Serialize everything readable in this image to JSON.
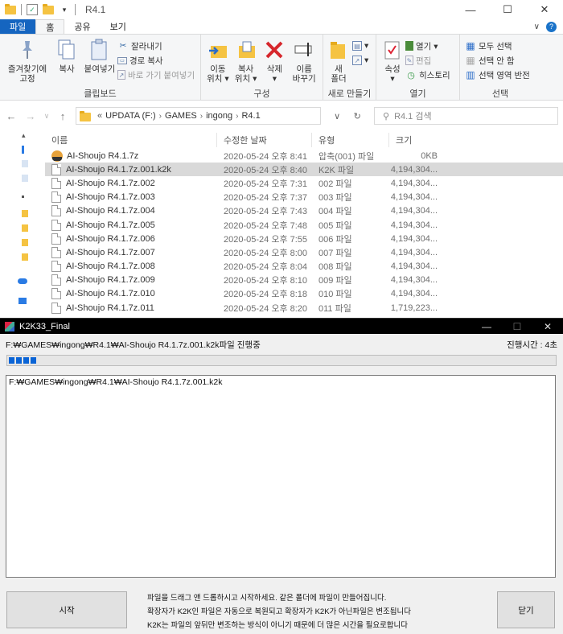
{
  "explorer": {
    "title": "R4.1",
    "window_controls": {
      "minimize": "—",
      "maximize": "☐",
      "close": "✕"
    },
    "tabs": [
      "파일",
      "홈",
      "공유",
      "보기"
    ],
    "ribbon": {
      "clipboard": {
        "label": "클립보드",
        "pin": "즐겨찾기에\n고정",
        "copy": "복사",
        "paste": "붙여넣기",
        "cut": "잘라내기",
        "copy_path": "경로 복사",
        "paste_shortcut": "바로 가기 붙여넣기"
      },
      "organize": {
        "label": "구성",
        "move_to": "이동\n위치 ▾",
        "copy_to": "복사\n위치 ▾",
        "delete": "삭제\n▾",
        "rename": "이름\n바꾸기"
      },
      "new": {
        "label": "새로 만들기",
        "new_folder": "새\n폴더"
      },
      "open": {
        "label": "열기",
        "properties": "속성\n▾",
        "open": "열기 ▾",
        "edit": "편집",
        "history": "히스토리"
      },
      "select": {
        "label": "선택",
        "select_all": "모두 선택",
        "select_none": "선택 안 함",
        "invert": "선택 영역 반전"
      }
    },
    "address": {
      "drive": "UPDATA (F:)",
      "path": [
        "GAMES",
        "ingong",
        "R4.1"
      ],
      "prefix": "«",
      "search_placeholder": "R4.1 검색"
    },
    "columns": {
      "name": "이름",
      "date": "수정한 날짜",
      "type": "유형",
      "size": "크기"
    },
    "files": [
      {
        "name": "AI-Shoujo R4.1.7z",
        "date": "2020-05-24 오후 8:41",
        "type": "압축(001) 파일",
        "size": "0KB",
        "icon": "archive-icon"
      },
      {
        "name": "AI-Shoujo R4.1.7z.001.k2k",
        "date": "2020-05-24 오후 8:40",
        "type": "K2K 파일",
        "size": "4,194,304...",
        "icon": "file-icon",
        "selected": true
      },
      {
        "name": "AI-Shoujo R4.1.7z.002",
        "date": "2020-05-24 오후 7:31",
        "type": "002 파일",
        "size": "4,194,304...",
        "icon": "file-icon"
      },
      {
        "name": "AI-Shoujo R4.1.7z.003",
        "date": "2020-05-24 오후 7:37",
        "type": "003 파일",
        "size": "4,194,304...",
        "icon": "file-icon"
      },
      {
        "name": "AI-Shoujo R4.1.7z.004",
        "date": "2020-05-24 오후 7:43",
        "type": "004 파일",
        "size": "4,194,304...",
        "icon": "file-icon"
      },
      {
        "name": "AI-Shoujo R4.1.7z.005",
        "date": "2020-05-24 오후 7:48",
        "type": "005 파일",
        "size": "4,194,304...",
        "icon": "file-icon"
      },
      {
        "name": "AI-Shoujo R4.1.7z.006",
        "date": "2020-05-24 오후 7:55",
        "type": "006 파일",
        "size": "4,194,304...",
        "icon": "file-icon"
      },
      {
        "name": "AI-Shoujo R4.1.7z.007",
        "date": "2020-05-24 오후 8:00",
        "type": "007 파일",
        "size": "4,194,304...",
        "icon": "file-icon"
      },
      {
        "name": "AI-Shoujo R4.1.7z.008",
        "date": "2020-05-24 오후 8:04",
        "type": "008 파일",
        "size": "4,194,304...",
        "icon": "file-icon"
      },
      {
        "name": "AI-Shoujo R4.1.7z.009",
        "date": "2020-05-24 오후 8:10",
        "type": "009 파일",
        "size": "4,194,304...",
        "icon": "file-icon"
      },
      {
        "name": "AI-Shoujo R4.1.7z.010",
        "date": "2020-05-24 오후 8:18",
        "type": "010 파일",
        "size": "4,194,304...",
        "icon": "file-icon"
      },
      {
        "name": "AI-Shoujo R4.1.7z.011",
        "date": "2020-05-24 오후 8:20",
        "type": "011 파일",
        "size": "1,719,223...",
        "icon": "file-icon"
      }
    ]
  },
  "k2k": {
    "title": "K2K33_Final",
    "status": "F:₩GAMES₩ingong₩R4.1₩AI-Shoujo R4.1.7z.001.k2k파일 진행중",
    "elapsed": "진행시간 : 4초",
    "progress_blocks": 4,
    "log": [
      "F:₩GAMES₩ingong₩R4.1₩AI-Shoujo R4.1.7z.001.k2k"
    ],
    "start_button": "시작",
    "close_button": "닫기",
    "info": [
      "파일을 드래그 앤 드롭하시고 시작하세요. 같은 폴더에 파일이 만들어집니다.",
      "확장자가 K2K인 파일은 자동으로 복원되고 확장자가 K2K가 아닌파일은 변조됩니다",
      "K2K는 파일의 앞뒤만 변조하는 방식이 아니기 때문에 더 많은 시간을 필요로합니다"
    ]
  }
}
